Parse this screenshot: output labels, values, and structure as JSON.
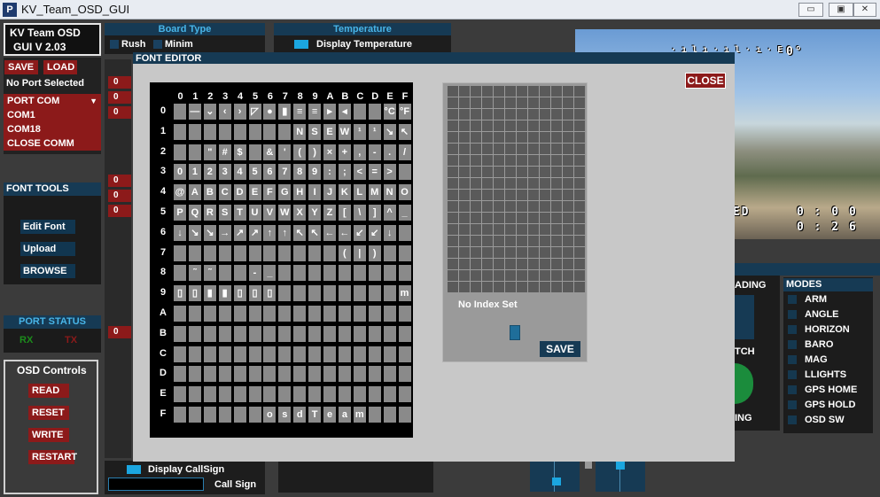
{
  "window": {
    "title": "KV_Team_OSD_GUI",
    "icon": "P",
    "min_label": "▭",
    "max_label": "▣",
    "close_label": "✕"
  },
  "left": {
    "app_name": "KV Team OSD",
    "gui_version": "GUI   V    2.03",
    "save": "SAVE",
    "load": "LOAD",
    "port_status_text": "No Port Selected",
    "port_com": "PORT COM",
    "com_items": [
      "COM1",
      "COM18",
      "CLOSE COMM"
    ],
    "font_tools_header": "FONT TOOLS",
    "edit_font": "Edit Font",
    "upload": "Upload",
    "browse": "BROWSE",
    "port_status_header": "PORT STATUS",
    "rx": "RX",
    "tx": "TX",
    "osd_controls": "OSD Controls",
    "read": "READ",
    "reset": "RESET",
    "write": "WRITE",
    "restart": "RESTART"
  },
  "board": {
    "header": "Board Type",
    "rush": "Rush",
    "minim": "Minim"
  },
  "temperature": {
    "header": "Temperature",
    "display": "Display Temperature"
  },
  "value_strip": [
    "0",
    "0",
    "0",
    "0",
    "0",
    "0",
    "0"
  ],
  "callsign": {
    "display": "Display CallSign",
    "label": "Call Sign"
  },
  "modal": {
    "title": "FONT EDITOR",
    "close": "CLOSE",
    "col_headers": [
      "0",
      "1",
      "2",
      "3",
      "4",
      "5",
      "6",
      "7",
      "8",
      "9",
      "A",
      "B",
      "C",
      "D",
      "E",
      "F"
    ],
    "row_headers": [
      "0",
      "1",
      "2",
      "3",
      "4",
      "5",
      "6",
      "7",
      "8",
      "9",
      "A",
      "B",
      "C",
      "D",
      "E",
      "F"
    ],
    "rows": [
      [
        "",
        "—",
        "⌄",
        "‹",
        "›",
        "◸",
        "●",
        "▮",
        "≡",
        "≡",
        "▸",
        "◂",
        "",
        "",
        "°C",
        "°F"
      ],
      [
        "",
        "",
        "",
        "",
        "",
        "",
        "",
        "",
        "N",
        "S",
        "E",
        "W",
        "¹",
        "¹",
        "↘",
        "↖"
      ],
      [
        "",
        "",
        "\"",
        "#",
        "$",
        "",
        "&",
        "'",
        "(",
        ")",
        "×",
        "+",
        ",",
        "-",
        ".",
        "/"
      ],
      [
        "0",
        "1",
        "2",
        "3",
        "4",
        "5",
        "6",
        "7",
        "8",
        "9",
        ":",
        ";",
        "<",
        "=",
        ">",
        ""
      ],
      [
        "@",
        "A",
        "B",
        "C",
        "D",
        "E",
        "F",
        "G",
        "H",
        "I",
        "J",
        "K",
        "L",
        "M",
        "N",
        "O"
      ],
      [
        "P",
        "Q",
        "R",
        "S",
        "T",
        "U",
        "V",
        "W",
        "X",
        "Y",
        "Z",
        "[",
        "\\",
        "]",
        "^",
        "_"
      ],
      [
        "↓",
        "↘",
        "↘",
        "→",
        "↗",
        "↗",
        "↑",
        "↑",
        "↖",
        "↖",
        "←",
        "←",
        "↙",
        "↙",
        "↓",
        ""
      ],
      [
        "",
        "",
        "",
        "",
        "",
        "",
        "",
        "",
        "",
        "",
        "",
        "(",
        "|",
        ")",
        "",
        ""
      ],
      [
        "",
        "˜",
        "˜",
        "",
        "",
        "-",
        "_",
        "",
        "",
        "",
        "",
        "",
        "",
        "",
        "",
        ""
      ],
      [
        "▯",
        "▯",
        "▮",
        "▮",
        "▯",
        "▯",
        "▯",
        "",
        "",
        "",
        "",
        "",
        "",
        "",
        "",
        "m"
      ],
      [
        "",
        "",
        "",
        "",
        "",
        "",
        "",
        "",
        "",
        "",
        "",
        "",
        "",
        "",
        "",
        ""
      ],
      [
        "",
        "",
        "",
        "",
        "",
        "",
        "",
        "",
        "",
        "",
        "",
        "",
        "",
        "",
        "",
        ""
      ],
      [
        "",
        "",
        "",
        "",
        "",
        "",
        "",
        "",
        "",
        "",
        "",
        "",
        "",
        "",
        "",
        ""
      ],
      [
        "",
        "",
        "",
        "",
        "",
        "",
        "",
        "",
        "",
        "",
        "",
        "",
        "",
        "",
        "",
        ""
      ],
      [
        "",
        "",
        "",
        "",
        "",
        "",
        "",
        "",
        "",
        "",
        "",
        "",
        "",
        "",
        "",
        ""
      ],
      [
        "",
        "",
        "",
        "",
        "",
        "",
        "o",
        "s",
        "d",
        "T",
        "e",
        "a",
        "m",
        "",
        "",
        ""
      ]
    ],
    "no_index": "No Index Set",
    "save": "SAVE"
  },
  "video": {
    "heading": "0°",
    "timer1": "0 : 0 0",
    "timer2": "0 : 2 6",
    "armed": "MED"
  },
  "right": {
    "heading_label": "ADING",
    "pitch_label": "TCH",
    "roll_label": "ING",
    "modes_header": "MODES",
    "modes": [
      "ARM",
      "ANGLE",
      "HORIZON",
      "BARO",
      "MAG",
      "LLIGHTS",
      "GPS HOME",
      "GPS HOLD",
      "OSD SW"
    ]
  },
  "colors": {
    "accent": "#1ba6e0",
    "header_bg": "#163a54",
    "button_red": "#8c1a1a",
    "rx_color": "#1c8c1c",
    "tx_color": "#8c1a1a"
  }
}
